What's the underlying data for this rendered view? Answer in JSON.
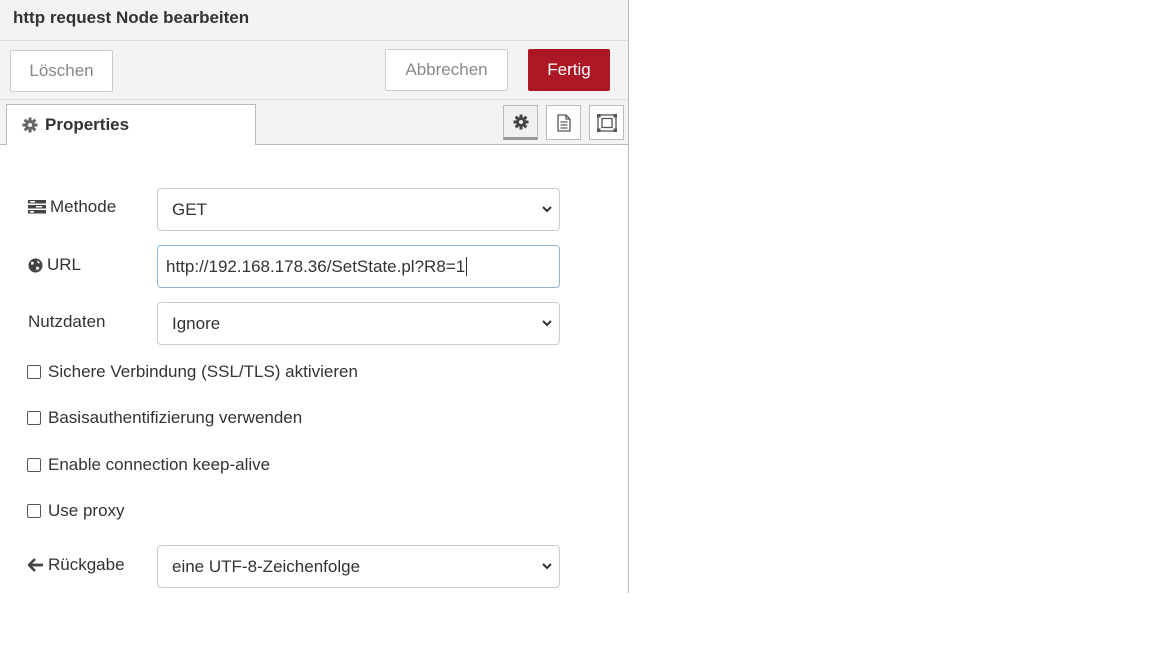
{
  "dialog": {
    "title": "http request Node bearbeiten",
    "buttons": {
      "delete": "Löschen",
      "cancel": "Abbrechen",
      "done": "Fertig"
    },
    "accent_color": "#ad1625"
  },
  "tabs": {
    "active_label": "Properties",
    "active_icon": "gear-icon",
    "side_buttons": [
      "gear-icon",
      "document-icon",
      "frame-icon"
    ]
  },
  "form": {
    "method": {
      "label": "Methode",
      "icon": "list-icon",
      "value": "GET"
    },
    "url": {
      "label": "URL",
      "icon": "globe-icon",
      "value": "http://192.168.178.36/SetState.pl?R8=1"
    },
    "payload": {
      "label": "Nutzdaten",
      "value": "Ignore"
    },
    "checkboxes": [
      {
        "label": "Sichere Verbindung (SSL/TLS) aktivieren",
        "checked": false
      },
      {
        "label": "Basisauthentifizierung verwenden",
        "checked": false
      },
      {
        "label": "Enable connection keep-alive",
        "checked": false
      },
      {
        "label": "Use proxy",
        "checked": false
      }
    ],
    "return": {
      "label": "Rückgabe",
      "icon": "arrow-left-icon",
      "value": "eine UTF-8-Zeichenfolge"
    }
  }
}
